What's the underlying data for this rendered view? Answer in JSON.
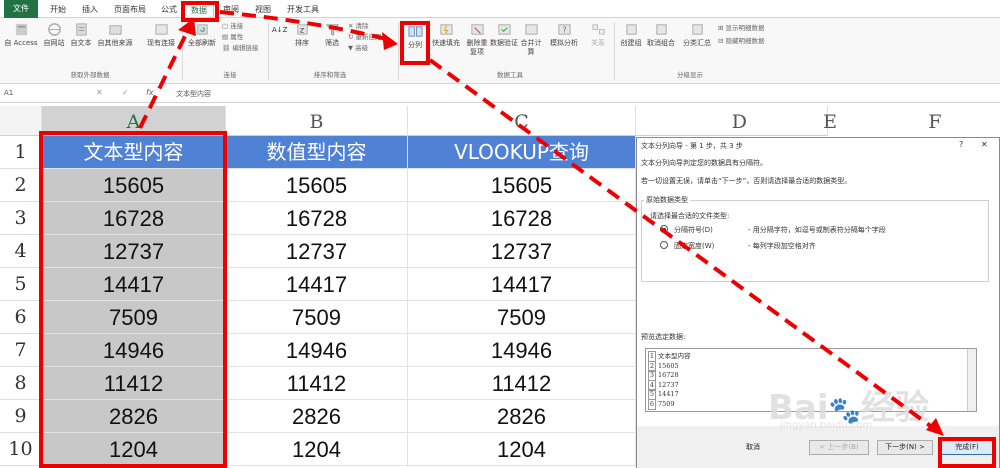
{
  "ribbon_tabs": [
    "文件",
    "开始",
    "插入",
    "页面布局",
    "公式",
    "数据",
    "审阅",
    "视图",
    "开发工具"
  ],
  "ribbon": {
    "get_external": [
      "自 Access",
      "自网站",
      "自文本",
      "自其他来源",
      "现有连接"
    ],
    "get_external_label": "获取外部数据",
    "refresh_all": "全部刷新",
    "connections_items": [
      "连接",
      "属性",
      "编辑链接"
    ],
    "connections_label": "连接",
    "sort_asc": "A↓Z",
    "sort": "排序",
    "filter": "筛选",
    "filter_items": [
      "清除",
      "重新应用",
      "高级"
    ],
    "sort_filter_label": "排序和筛选",
    "text_to_columns": "分列",
    "flash_fill": "快速填充",
    "remove_dup": "删除重复项",
    "validation": "数据验证",
    "consolidate": "合并计算",
    "whatif": "模拟分析",
    "relationships": "关系",
    "data_tools_label": "数据工具",
    "group": "创建组",
    "ungroup": "取消组合",
    "subtotal": "分类汇总",
    "outline_items": [
      "显示明细数据",
      "隐藏明细数据"
    ],
    "outline_label": "分级显示"
  },
  "formula_bar": {
    "name_box": "A1",
    "fx": "fx",
    "content": "文本型内容"
  },
  "columns": [
    "A",
    "B",
    "C",
    "D",
    "E",
    "F"
  ],
  "rows": [
    "1",
    "2",
    "3",
    "4",
    "5",
    "6",
    "7",
    "8",
    "9",
    "10"
  ],
  "table": {
    "headers": [
      "文本型内容",
      "数值型内容",
      "VLOOKUP查询"
    ],
    "values": [
      [
        "15605",
        "15605",
        "15605"
      ],
      [
        "16728",
        "16728",
        "16728"
      ],
      [
        "12737",
        "12737",
        "12737"
      ],
      [
        "14417",
        "14417",
        "14417"
      ],
      [
        "7509",
        "7509",
        "7509"
      ],
      [
        "14946",
        "14946",
        "14946"
      ],
      [
        "11412",
        "11412",
        "11412"
      ],
      [
        "2826",
        "2826",
        "2826"
      ],
      [
        "1204",
        "1204",
        "1204"
      ]
    ]
  },
  "dialog": {
    "title": "文本分列向导 - 第 1 步，共 3 步",
    "help": "?",
    "close": "✕",
    "line1": "文本分列向导判定您的数据具有分隔符。",
    "line2": "若一切设置无误，请单击“下一步”，否则请选择最合适的数据类型。",
    "group_title": "原始数据类型",
    "group_prompt": "请选择最合适的文件类型:",
    "opt1": "分隔符号(D)",
    "opt1_desc": "- 用分隔字符，如逗号或制表符分隔每个字段",
    "opt2": "固定宽度(W)",
    "opt2_desc": "- 每列字段加空格对齐",
    "preview_label": "预览选定数据:",
    "preview_rows": [
      [
        "1",
        "文本型内容"
      ],
      [
        "2",
        "15605"
      ],
      [
        "3",
        "16728"
      ],
      [
        "4",
        "12737"
      ],
      [
        "5",
        "14417"
      ],
      [
        "6",
        "7509"
      ]
    ],
    "buttons": {
      "cancel": "取消",
      "back": "< 上一步(B)",
      "next": "下一步(N) >",
      "finish": "完成(F)"
    }
  },
  "watermark": {
    "brand": "Bai",
    "brand2": "经验",
    "url": "jingyan.baidu.com"
  },
  "colors": {
    "header_fill": "#4f81d4",
    "selection": "#c8c8c8",
    "annotation": "#ee0000",
    "excel_green": "#217346"
  }
}
